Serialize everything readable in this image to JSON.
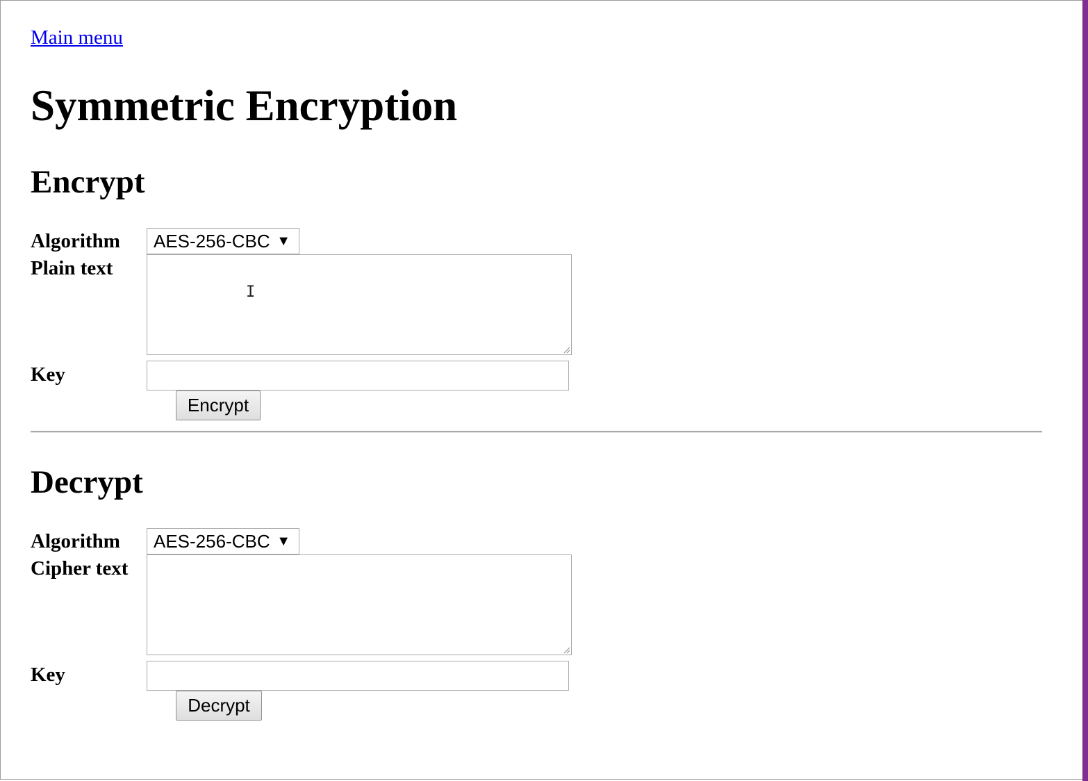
{
  "nav": {
    "main_menu_label": "Main menu"
  },
  "page": {
    "title": "Symmetric Encryption"
  },
  "encrypt": {
    "heading": "Encrypt",
    "algorithm_label": "Algorithm",
    "algorithm_value": "AES-256-CBC",
    "text_label": "Plain text",
    "text_value": "",
    "key_label": "Key",
    "key_value": "",
    "button_label": "Encrypt"
  },
  "decrypt": {
    "heading": "Decrypt",
    "algorithm_label": "Algorithm",
    "algorithm_value": "AES-256-CBC",
    "text_label": "Cipher text",
    "text_value": "",
    "key_label": "Key",
    "key_value": "",
    "button_label": "Decrypt"
  },
  "icons": {
    "dropdown": "chevron-down-icon",
    "resize": "resize-grip-icon",
    "cursor": "text-cursor-icon"
  },
  "colors": {
    "link": "#0000ee",
    "window_accent": "#7f2f8f",
    "border": "#a9a9a9"
  }
}
